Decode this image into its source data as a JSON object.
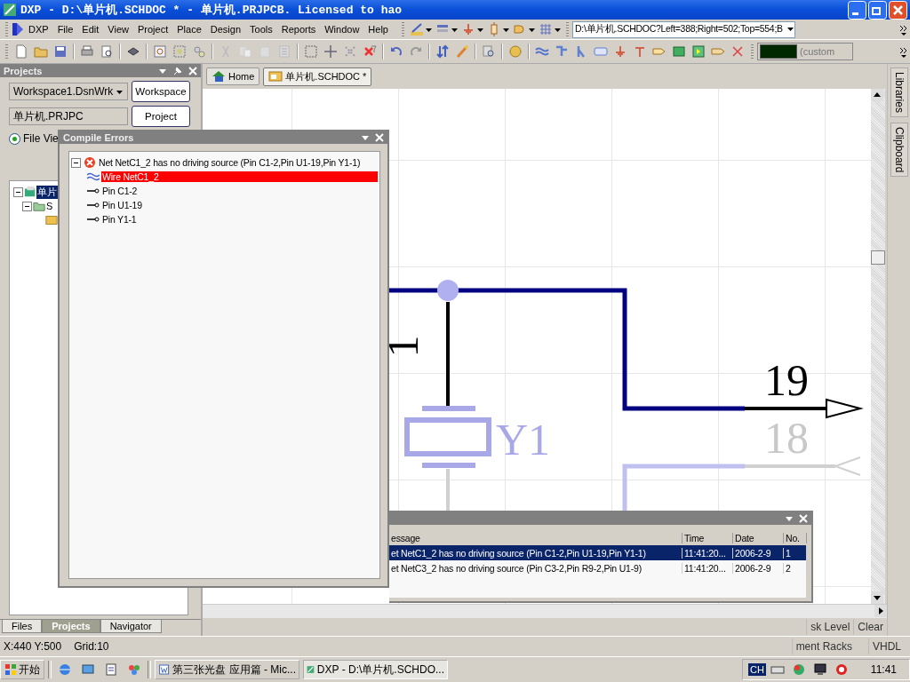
{
  "window": {
    "title": "DXP - D:\\单片机.SCHDOC * - 单片机.PRJPCB. Licensed to hao"
  },
  "menu": [
    "DXP",
    "File",
    "Edit",
    "View",
    "Project",
    "Place",
    "Design",
    "Tools",
    "Reports",
    "Window",
    "Help"
  ],
  "address_field": {
    "value": "D:\\单片机.SCHDOC?Left=388;Right=502;Top=554;B"
  },
  "color_field": {
    "value": "(custom"
  },
  "projects_panel": {
    "title": "Projects",
    "workspace": {
      "value": "Workspace1.DsnWrk"
    },
    "workspace_button": "Workspace",
    "project": {
      "value": "单片机.PRJPC"
    },
    "project_button": "Project",
    "view_option": {
      "label": "File Vie",
      "checked": true
    },
    "tree": [
      {
        "label": "单片",
        "selected": true,
        "expanded": true,
        "children": [
          {
            "label": "S",
            "selected": false,
            "expanded": true
          }
        ]
      }
    ],
    "tabs": [
      {
        "label": "Files",
        "selected": false
      },
      {
        "label": "Projects",
        "selected": true
      },
      {
        "label": "Navigator",
        "selected": false
      }
    ]
  },
  "document_tabs": [
    {
      "label": "Home",
      "selected": false
    },
    {
      "label": "单片机.SCHDOC *",
      "selected": true
    }
  ],
  "schematic": {
    "labels": [
      {
        "kind": "pin-number",
        "text": "1"
      },
      {
        "kind": "pin-number",
        "text": "19"
      },
      {
        "kind": "designator",
        "text": "Y1"
      },
      {
        "kind": "dim-pin-number",
        "text": "18"
      }
    ]
  },
  "compile_errors": {
    "title": "Compile Errors",
    "tree": [
      {
        "kind": "error",
        "label": "Net NetC1_2 has no driving source (Pin C1-2,Pin U1-19,Pin Y1-1)",
        "selected": false,
        "expanded": true,
        "children": [
          {
            "kind": "wire",
            "label": "Wire NetC1_2",
            "selected": true
          },
          {
            "kind": "pin",
            "label": "Pin C1-2",
            "selected": false
          },
          {
            "kind": "pin",
            "label": "Pin U1-19",
            "selected": false
          },
          {
            "kind": "pin",
            "label": "Pin Y1-1",
            "selected": false
          }
        ]
      }
    ]
  },
  "messages": {
    "columns": [
      "essage",
      "Time",
      "Date",
      "No."
    ],
    "rows": [
      {
        "cells": [
          "et NetC1_2 has no driving source (Pin C1-2,Pin U1-19,Pin Y1-1)",
          "11:41:20...",
          "2006-2-9",
          "1"
        ],
        "selected": true
      },
      {
        "cells": [
          "et NetC3_2 has no driving source (Pin C3-2,Pin R9-2,Pin U1-9)",
          "11:41:20...",
          "2006-2-9",
          "2"
        ],
        "selected": false
      }
    ]
  },
  "canvas_buttons": [
    "sk Level",
    "Clear"
  ],
  "side_tabs": [
    "Libraries",
    "Clipboard"
  ],
  "status_bar": {
    "coordinates": "X:440 Y:500",
    "grid": "Grid:10",
    "panel_tabs": [
      "ment Racks",
      "VHDL"
    ]
  },
  "taskbar": {
    "start": "开始",
    "tasks": [
      {
        "label": "第三张光盘 应用篇 - Mic...",
        "selected": false
      },
      {
        "label": "DXP - D:\\单片机.SCHDO...",
        "selected": true
      }
    ],
    "language": "CH",
    "time": "11:41"
  }
}
